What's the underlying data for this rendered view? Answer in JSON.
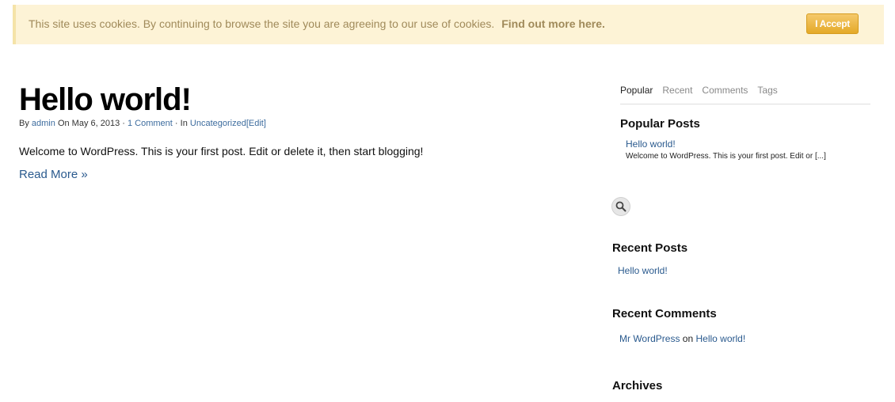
{
  "cookie": {
    "message": "This site uses cookies. By continuing to browse the site you are agreeing to our use of cookies.",
    "link_label": "Find out more here.",
    "accept_label": "I Accept"
  },
  "post": {
    "title": "Hello world!",
    "meta": {
      "by": "By",
      "author": "admin",
      "on_date": "On May 6, 2013 ·",
      "comments": "1 Comment",
      "in": "· In",
      "category": "Uncategorized",
      "edit": "[Edit]"
    },
    "content": "Welcome to WordPress. This is your first post. Edit or delete it, then start blogging!",
    "read_more": "Read More »"
  },
  "sidebar": {
    "tabs": [
      {
        "label": "Popular",
        "active": true
      },
      {
        "label": "Recent"
      },
      {
        "label": "Comments"
      },
      {
        "label": "Tags"
      }
    ],
    "popular": {
      "title": "Popular Posts",
      "link": "Hello world!",
      "excerpt": "Welcome to WordPress. This is your first post. Edit or [...]"
    },
    "search_icon": "search-icon",
    "recent_posts": {
      "title": "Recent Posts",
      "items": [
        "Hello world!"
      ]
    },
    "recent_comments": {
      "title": "Recent Comments",
      "author": "Mr WordPress",
      "on": "on",
      "post": "Hello world!"
    },
    "archives": {
      "title": "Archives"
    }
  }
}
